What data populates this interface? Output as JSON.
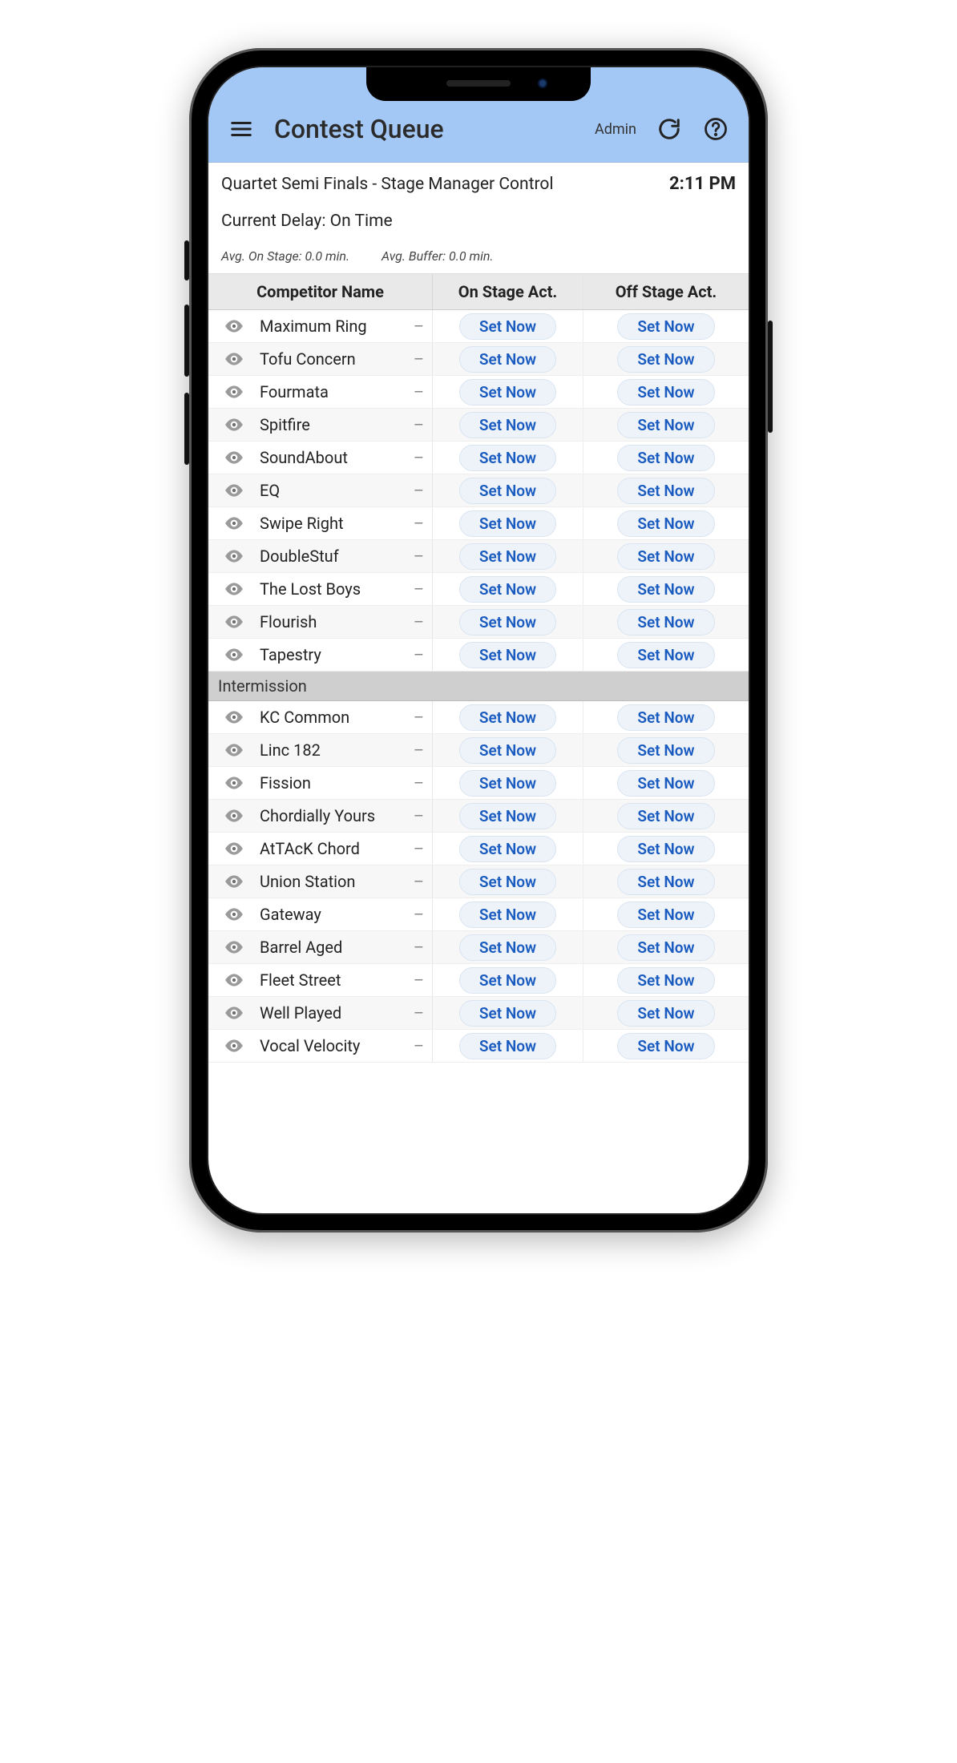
{
  "header": {
    "title": "Contest Queue",
    "admin_label": "Admin"
  },
  "subheader": {
    "event_title": "Quartet Semi Finals - Stage Manager Control",
    "time": "2:11 PM",
    "delay_label": "Current Delay: On Time",
    "avg_on_stage": "Avg. On Stage: 0.0 min.",
    "avg_buffer": "Avg. Buffer: 0.0 min."
  },
  "columns": {
    "name": "Competitor Name",
    "on": "On Stage Act.",
    "off": "Off Stage Act."
  },
  "button_label": "Set Now",
  "section_label": "Intermission",
  "rows_before": [
    {
      "name": "Maximum Ring"
    },
    {
      "name": "Tofu Concern"
    },
    {
      "name": "Fourmata"
    },
    {
      "name": "Spitfire"
    },
    {
      "name": "SoundAbout"
    },
    {
      "name": "EQ"
    },
    {
      "name": "Swipe Right"
    },
    {
      "name": "DoubleStuf"
    },
    {
      "name": "The Lost Boys"
    },
    {
      "name": "Flourish"
    },
    {
      "name": "Tapestry"
    }
  ],
  "rows_after": [
    {
      "name": "KC Common"
    },
    {
      "name": "Linc 182"
    },
    {
      "name": "Fission"
    },
    {
      "name": "Chordially Yours"
    },
    {
      "name": "AtTAcK Chord"
    },
    {
      "name": "Union Station"
    },
    {
      "name": "Gateway"
    },
    {
      "name": "Barrel Aged"
    },
    {
      "name": "Fleet Street"
    },
    {
      "name": "Well Played"
    },
    {
      "name": "Vocal Velocity"
    }
  ]
}
